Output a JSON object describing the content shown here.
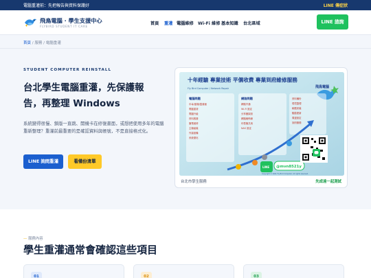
{
  "topbar": {
    "message": "電腦重灌前：先把報告與資料保護好",
    "line_link": "LINE 傳症狀"
  },
  "header": {
    "brand": "飛鳥電腦 · 學生支援中心",
    "brand_sub": "FLYBIRD STUDENT IT CARE",
    "nav": [
      "首頁",
      "重灌",
      "電腦維修",
      "Wi-Fi 維修",
      "基本知識",
      "台北區域"
    ],
    "line_button": "LINE 諮詢"
  },
  "breadcrumb": {
    "home": "首頁",
    "sep1": "/",
    "service": "服務",
    "sep2": "/",
    "current": "電腦重灌"
  },
  "hero": {
    "eyebrow": "STUDENT COMPUTER REINSTALL",
    "title": "台北學生電腦重灌，先保護報告，再整理 Windows",
    "lead": "系統變得很慢、鎖版一直跳、開機卡在修復畫面，或想把使用多年的電腦重新整理？重灌前最重要的是確認資料與帳號，不是直接格式化。",
    "primary_button": "LINE 詢問重灌",
    "secondary_button": "看備份清單"
  },
  "card": {
    "poster": {
      "brand": "飛鳥電腦",
      "headline": "十年經驗 專業技術 平價收費 專業到府維修服務",
      "sub": "Fly Bird Computer / Network Repair",
      "col1_title": "電腦問題",
      "col2_title": "網路問題",
      "col1_items": [
        "中毒/當機/藍畫面",
        "電腦重灌",
        "電腦升級",
        "資料救援",
        "筆電維修",
        "主機組裝",
        "外接設備",
        "系統優化"
      ],
      "col2_items": [
        "網路不通",
        "Wi-Fi 設定",
        "分享器架設",
        "網路線佈線",
        "印表機共用",
        "NAS 設定"
      ],
      "col3_items": [
        "資料備份",
        "環境整理",
        "軟體安裝",
        "驅動更新",
        "周邊設定",
        "到府服務"
      ],
      "line_badge": "LINE",
      "line_id": "@mvn8521y",
      "copyright": "Copyright © 2021 Fly Bird Computer. All rights reserved."
    },
    "footer_left": "台北市學生服務",
    "footer_right": "先成遠一起測試"
  },
  "services": {
    "eyebrow": "服務內容",
    "title": "學生重灌通常會確認這些項目",
    "items": [
      {
        "num": "01"
      },
      {
        "num": "02"
      },
      {
        "num": "03"
      }
    ]
  },
  "colors": {
    "topbar": "#17386e",
    "primary": "#1b5fcf",
    "line_green": "#1fc15e",
    "accent_yellow": "#ffc928"
  }
}
